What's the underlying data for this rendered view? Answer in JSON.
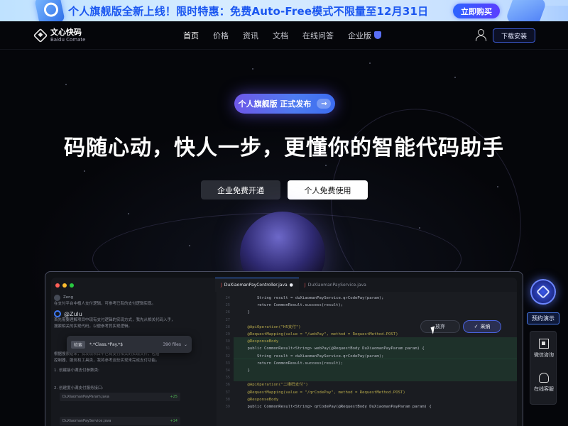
{
  "promo": {
    "text": "个人旗舰版全新上线！限时特惠：免费Auto-Free模式不限量至12月31日",
    "cta": "立即购买"
  },
  "nav": {
    "logo_cn": "文心快码",
    "logo_en": "Baidu Comate",
    "items": [
      "首页",
      "价格",
      "资讯",
      "文档",
      "在线问答",
      "企业版"
    ],
    "active": "首页",
    "download": "下载安装"
  },
  "hero": {
    "pill": "个人旗舰版 正式发布",
    "pill_arrow": "→",
    "headline": "码随心动，快人一步，更懂你的智能代码助手",
    "btn_enterprise": "企业免费开通",
    "btn_personal": "个人免费使用"
  },
  "demo": {
    "chat_user": "Zeng",
    "chat_line1": "在支付平台中植人支付逻辑，可参考已有的支付逻辑实现。",
    "agent_name": "@Zulu",
    "chat_line2": "首先需要理解项目中现有支付逻辑的实现方式，我先从相关代码入手，",
    "chat_line3": "搜索相关的实现代码，以便参考其实现逻辑。",
    "search_tag": "检索",
    "search_query": "*.*Class.*Pay.*$",
    "search_files": "390 files",
    "chat_line4": "根据搜索结果，我发现项目中已有支付相关的实现文件，包括",
    "chat_line5": "控制器、服务和工具类，我将参考这些实现来完成支付功能。",
    "step1": "1. 创建接小满支付参数类:",
    "file1": "DuXiaomanPayParam.java",
    "file1_diff": "+25",
    "step2": "2. 创建度小满支付服务接口:",
    "file2": "DuXiaomanPayService.java",
    "file2_diff": "+14",
    "tab_active": "DuXiaomanPayController.java",
    "tab_other": "DuXiaomanPayService.java",
    "btn_cancel": "放弃",
    "btn_accept": "采纳",
    "code_lines": [
      {
        "t": "        String result = duXiaomanPayService.qrCodePay(param);",
        "c": ""
      },
      {
        "t": "        return CommonResult.success(result);",
        "c": ""
      },
      {
        "t": "    }",
        "c": ""
      },
      {
        "t": "",
        "c": ""
      },
      {
        "t": "    @ApiOperation(\"H5支付\")",
        "c": "c-ann"
      },
      {
        "t": "    @RequestMapping(value = \"/webPay\", method = RequestMethod.POST)",
        "c": "c-ann"
      },
      {
        "t": "    @ResponseBody",
        "c": "c-ann"
      },
      {
        "t": "    public CommonResult<String> webPay(@RequestBody DuXiaomanPayParam param) {",
        "c": ""
      },
      {
        "t": "        String result = duXiaomanPayService.qrCodePay(param);",
        "c": ""
      },
      {
        "t": "        return CommonResult.success(result);",
        "c": ""
      },
      {
        "t": "    }",
        "c": ""
      },
      {
        "t": "",
        "c": ""
      },
      {
        "t": "    @ApiOperation(\"二维码支付\")",
        "c": "c-ann"
      },
      {
        "t": "    @RequestMapping(value = \"/qrCodePay\", method = RequestMethod.POST)",
        "c": "c-ann"
      },
      {
        "t": "    @ResponseBody",
        "c": "c-ann"
      },
      {
        "t": "    public CommonResult<String> qrCodePay(@RequestBody DuXiaomanPayParam param) {",
        "c": ""
      }
    ],
    "line_numbers": [
      "24",
      "25",
      "26",
      "27",
      "28",
      "29",
      "30",
      "31",
      "32",
      "33",
      "34",
      "35",
      "36",
      "37",
      "38",
      "39"
    ]
  },
  "side": {
    "demo": "预约演示",
    "wechat": "微信咨询",
    "service": "在线客服"
  }
}
